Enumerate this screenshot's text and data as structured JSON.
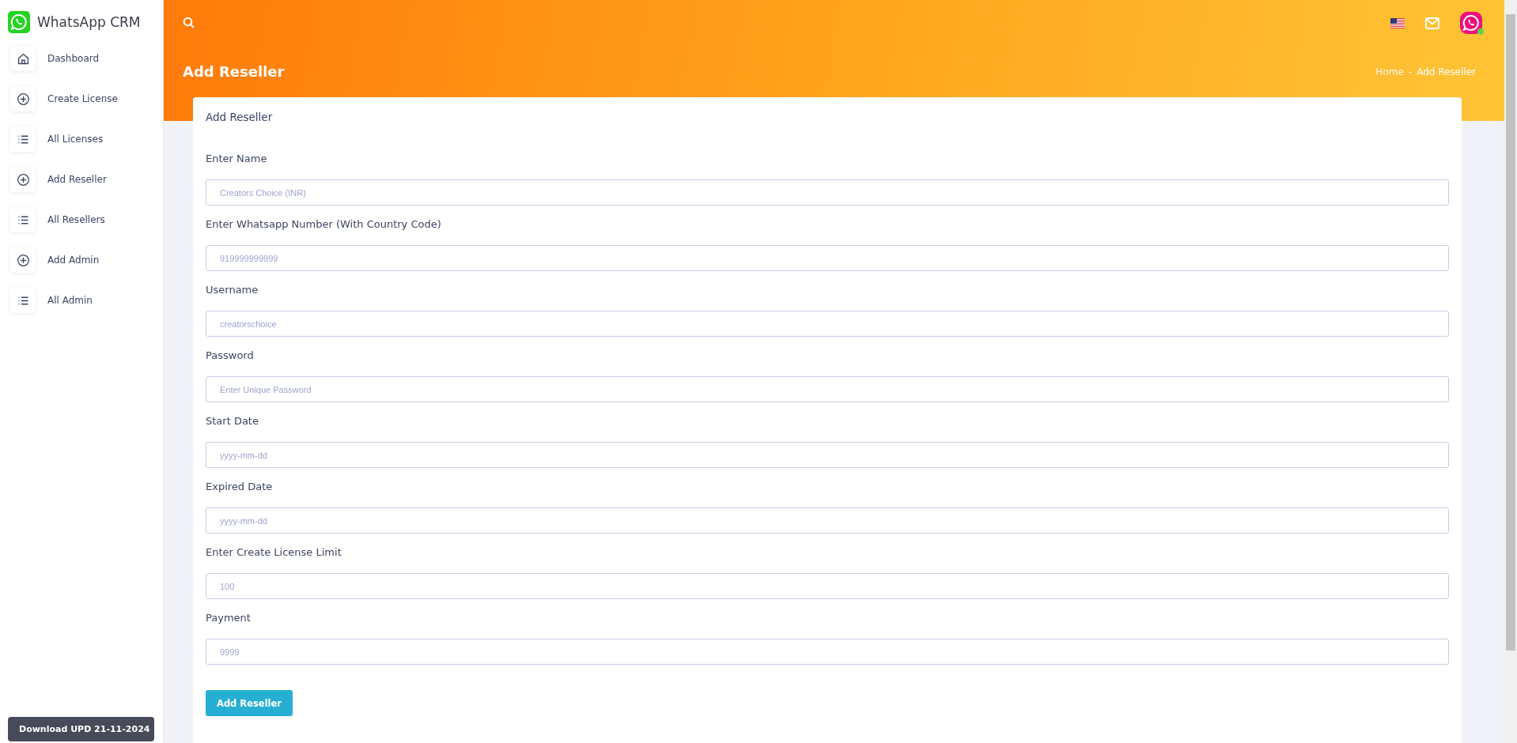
{
  "brand": {
    "name": "WhatsApp CRM"
  },
  "sidebar": {
    "items": [
      {
        "label": "Dashboard",
        "kind": "home"
      },
      {
        "label": "Create License",
        "kind": "add"
      },
      {
        "label": "All Licenses",
        "kind": "list"
      },
      {
        "label": "Add Reseller",
        "kind": "add"
      },
      {
        "label": "All Resellers",
        "kind": "list"
      },
      {
        "label": "Add Admin",
        "kind": "add"
      },
      {
        "label": "All Admin",
        "kind": "list"
      }
    ],
    "download_button": "Download UPD 21-11-2024"
  },
  "header": {
    "page_title": "Add Reseller",
    "breadcrumb": [
      "Home",
      "Add Reseller"
    ],
    "breadcrumb_separator": "-"
  },
  "form": {
    "title": "Add Reseller",
    "fields": [
      {
        "label": "Enter Name",
        "placeholder": "Creators Choice (INR)"
      },
      {
        "label": "Enter Whatsapp Number (With Country Code)",
        "placeholder": "919999999999"
      },
      {
        "label": "Username",
        "placeholder": "creatorschoice"
      },
      {
        "label": "Password",
        "placeholder": "Enter Unique Password"
      },
      {
        "label": "Start Date",
        "placeholder": "yyyy-mm-dd"
      },
      {
        "label": "Expired Date",
        "placeholder": "yyyy-mm-dd"
      },
      {
        "label": "Enter Create License Limit",
        "placeholder": "100"
      },
      {
        "label": "Payment",
        "placeholder": "9999"
      }
    ],
    "submit": "Add Reseller"
  }
}
